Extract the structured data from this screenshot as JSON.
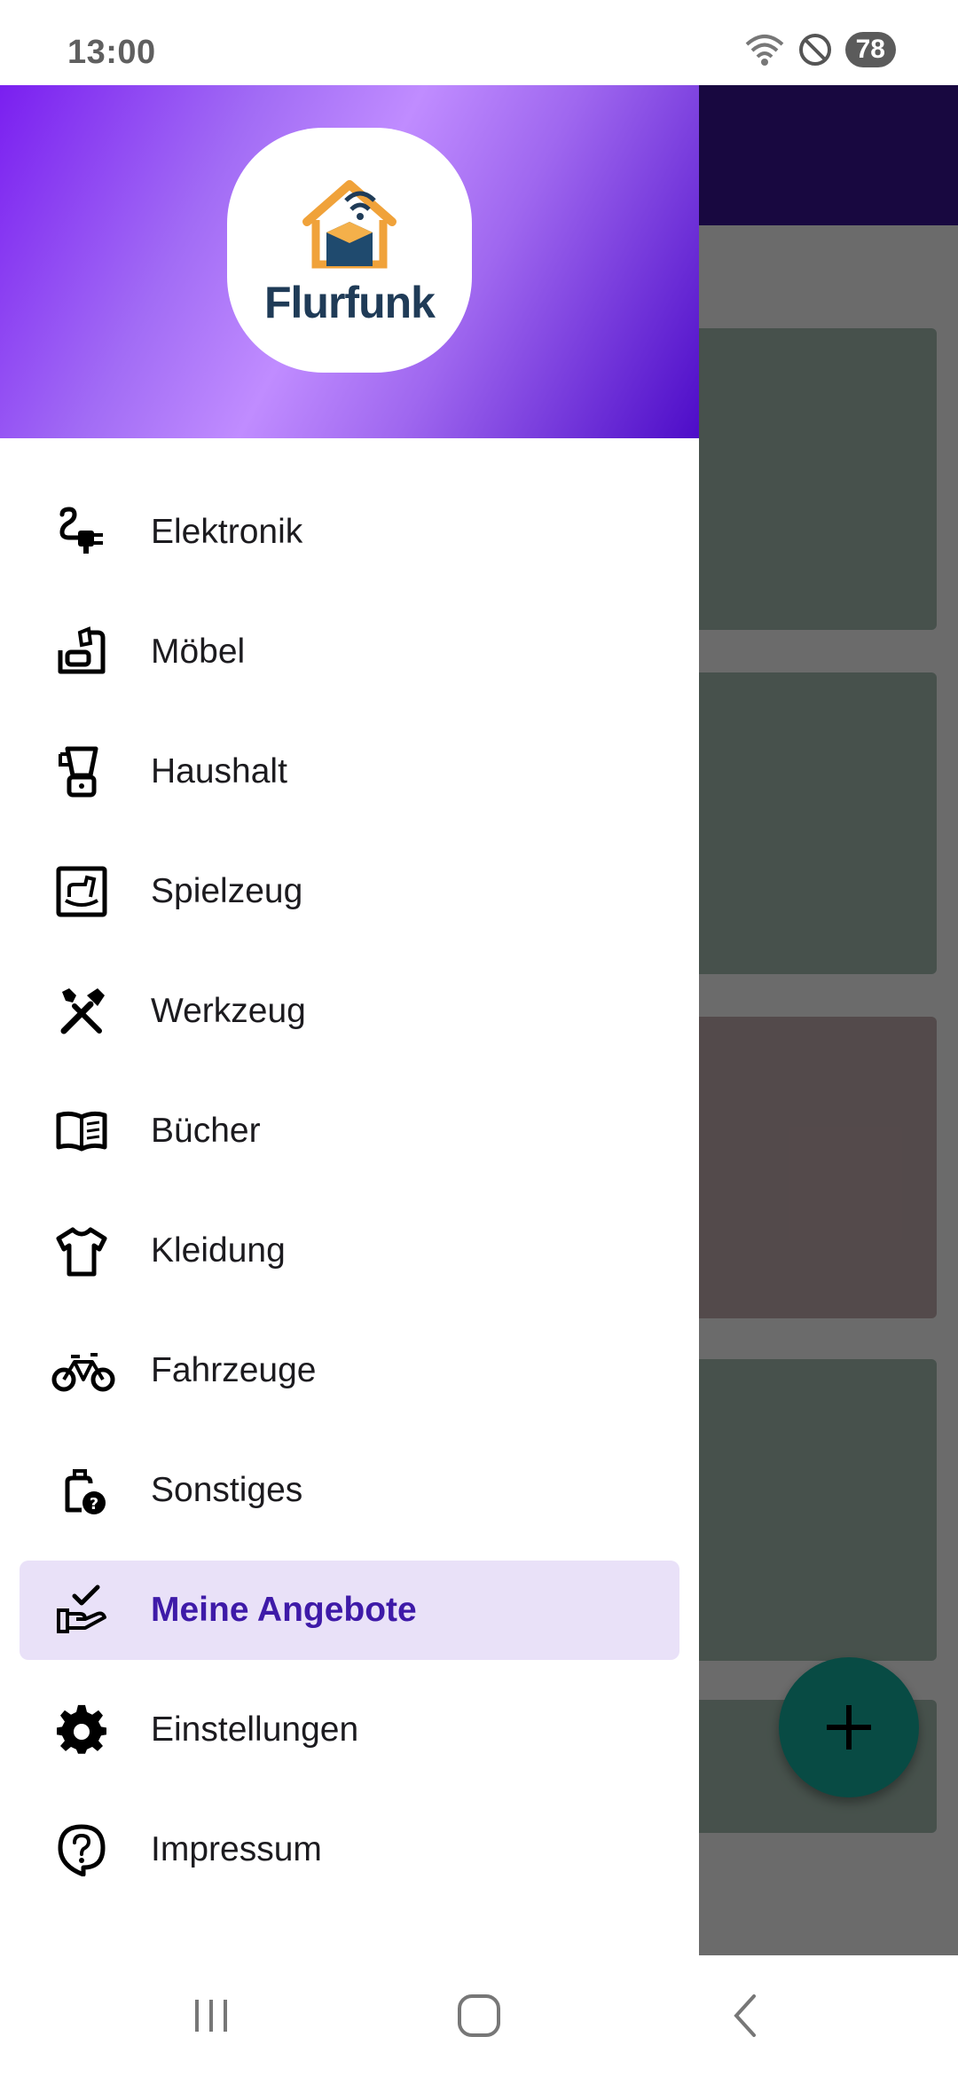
{
  "status": {
    "time": "13:00",
    "battery": "78"
  },
  "app": {
    "logo_text": "Flurfunk",
    "fab_icon": "plus-icon",
    "colors": {
      "toolbar": "#3a1499",
      "fab": "#13b4a2",
      "accent": "#3e1aa8",
      "active_bg": "#e9e1f8"
    }
  },
  "menu": {
    "items": [
      {
        "label": "Elektronik",
        "icon": "plug-icon"
      },
      {
        "label": "Möbel",
        "icon": "furniture-icon"
      },
      {
        "label": "Haushalt",
        "icon": "blender-icon"
      },
      {
        "label": "Spielzeug",
        "icon": "rocking-horse-icon"
      },
      {
        "label": "Werkzeug",
        "icon": "tools-icon"
      },
      {
        "label": "Bücher",
        "icon": "book-icon"
      },
      {
        "label": "Kleidung",
        "icon": "shirt-icon"
      },
      {
        "label": "Fahrzeuge",
        "icon": "bicycle-icon"
      },
      {
        "label": "Sonstiges",
        "icon": "bag-question-icon"
      },
      {
        "label": "Meine Angebote",
        "icon": "hand-check-icon",
        "active": true
      },
      {
        "label": "Einstellungen",
        "icon": "gear-icon"
      },
      {
        "label": "Impressum",
        "icon": "help-icon"
      }
    ]
  }
}
